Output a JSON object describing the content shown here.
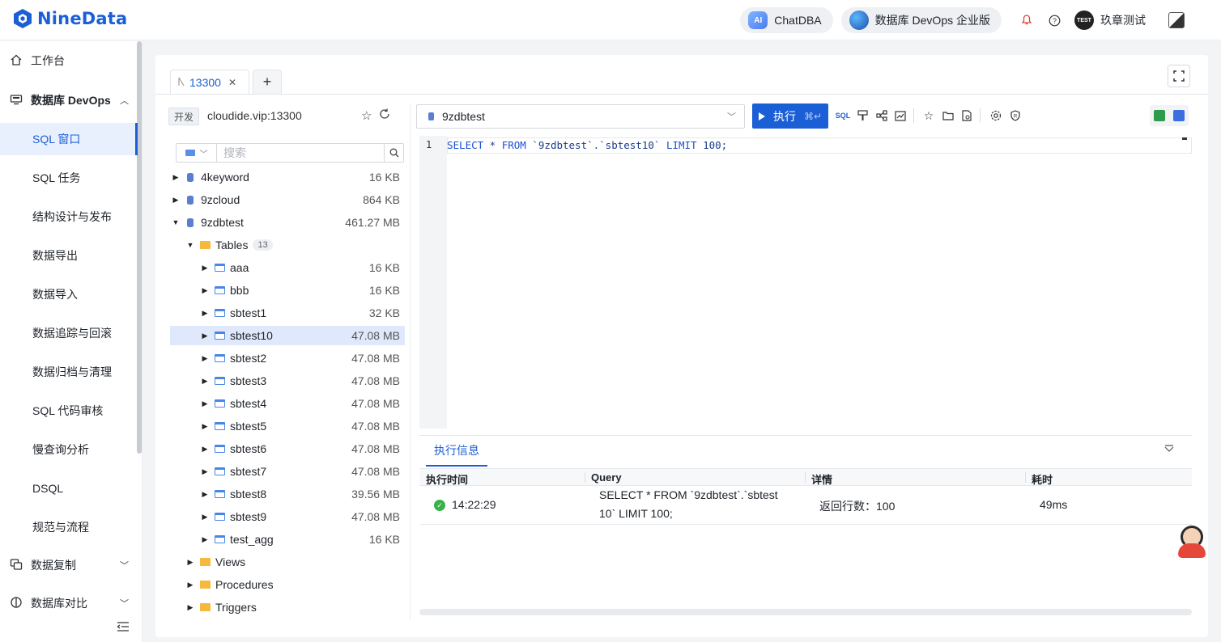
{
  "header": {
    "brand": "NineData",
    "chatdba": "ChatDBA",
    "ai_badge": "AI",
    "edition": "数据库 DevOps 企业版",
    "avatar_text": "TEST",
    "username": "玖章测试"
  },
  "sidebar": {
    "workbench": "工作台",
    "devops": "数据库 DevOps",
    "items": [
      {
        "label": "SQL 窗口",
        "active": true
      },
      {
        "label": "SQL 任务"
      },
      {
        "label": "结构设计与发布"
      },
      {
        "label": "数据导出"
      },
      {
        "label": "数据导入"
      },
      {
        "label": "数据追踪与回滚"
      },
      {
        "label": "数据归档与清理"
      },
      {
        "label": "SQL 代码审核"
      },
      {
        "label": "慢查询分析"
      },
      {
        "label": "DSQL"
      },
      {
        "label": "规范与流程"
      }
    ],
    "replication": "数据复制",
    "compare": "数据库对比"
  },
  "tabs": [
    {
      "label": "13300"
    }
  ],
  "connection": {
    "env": "开发",
    "name": "cloudide.vip:13300"
  },
  "search": {
    "placeholder": "搜索"
  },
  "tree": {
    "databases": [
      {
        "name": "4keyword",
        "size": "16 KB"
      },
      {
        "name": "9zcloud",
        "size": "864 KB"
      },
      {
        "name": "9zdbtest",
        "size": "461.27 MB"
      }
    ],
    "tables_label": "Tables",
    "tables_count": "13",
    "tables": [
      {
        "name": "aaa",
        "size": "16 KB"
      },
      {
        "name": "bbb",
        "size": "16 KB"
      },
      {
        "name": "sbtest1",
        "size": "32 KB"
      },
      {
        "name": "sbtest10",
        "size": "47.08 MB",
        "selected": true
      },
      {
        "name": "sbtest2",
        "size": "47.08 MB"
      },
      {
        "name": "sbtest3",
        "size": "47.08 MB"
      },
      {
        "name": "sbtest4",
        "size": "47.08 MB"
      },
      {
        "name": "sbtest5",
        "size": "47.08 MB"
      },
      {
        "name": "sbtest6",
        "size": "47.08 MB"
      },
      {
        "name": "sbtest7",
        "size": "47.08 MB"
      },
      {
        "name": "sbtest8",
        "size": "39.56 MB"
      },
      {
        "name": "sbtest9",
        "size": "47.08 MB"
      },
      {
        "name": "test_agg",
        "size": "16 KB"
      }
    ],
    "views": "Views",
    "procedures": "Procedures",
    "triggers": "Triggers"
  },
  "editor": {
    "database": "9zdbtest",
    "run_label": "执行",
    "run_shortcut": "⌘↵",
    "line_number": "1",
    "sql_kw1": "SELECT",
    "sql_mid": " * ",
    "sql_kw2": "FROM",
    "sql_obj": " `9zdbtest`.`sbtest10` ",
    "sql_kw3": "LIMIT",
    "sql_tail": " 100;"
  },
  "result": {
    "tab": "执行信息",
    "columns": [
      "执行时间",
      "Query",
      "详情",
      "耗时"
    ],
    "row": {
      "time": "14:22:29",
      "query_line1": "SELECT * FROM `9zdbtest`.`sbtest",
      "query_line2": "10` LIMIT 100;",
      "detail": "返回行数：100",
      "duration": "49ms"
    }
  },
  "colors": {
    "accent": "#1b5fd6",
    "success": "#38b24a",
    "folder": "#f6b93b"
  }
}
